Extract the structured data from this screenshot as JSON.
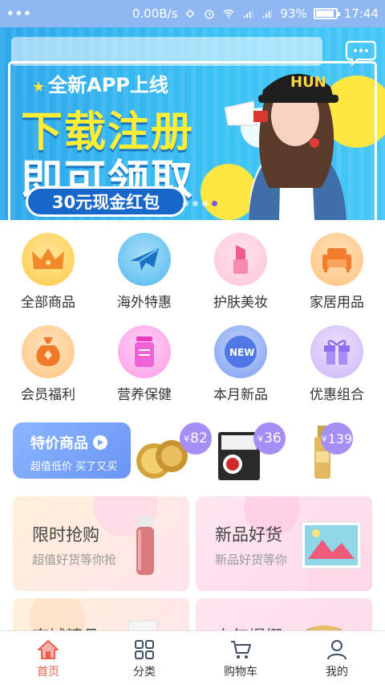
{
  "status_bar": {
    "speed": "0.00B/s",
    "battery_pct": "93%",
    "battery_level": 0.93,
    "time": "17:44"
  },
  "banner": {
    "tag": "全新APP上线",
    "line1": "下载注册",
    "line2": "即可领取",
    "pill": "30元现金红包",
    "cap_text": "HUN",
    "active_dot": 3
  },
  "categories": [
    {
      "label": "全部商品",
      "icon": "crown-icon",
      "color": "#ffd86e"
    },
    {
      "label": "海外特惠",
      "icon": "airplane-icon",
      "color": "#82cff6"
    },
    {
      "label": "护肤美妆",
      "icon": "lipstick-icon",
      "color": "#ffd0e0"
    },
    {
      "label": "家居用品",
      "icon": "sofa-icon",
      "color": "#ffd6a6"
    },
    {
      "label": "会员福利",
      "icon": "money-bag-icon",
      "color": "#ffd8a6"
    },
    {
      "label": "营养保健",
      "icon": "supplement-jar-icon",
      "color": "#ffc3ee"
    },
    {
      "label": "本月新品",
      "icon": "new-badge-icon",
      "color": "#a5bff7"
    },
    {
      "label": "优惠组合",
      "icon": "gift-icon",
      "color": "#dccbf9"
    }
  ],
  "special": {
    "title": "特价商品",
    "subtitle": "超值低价 买了又买"
  },
  "products": [
    {
      "price": "82",
      "currency": "¥",
      "icon": "eye-mask-jar-icon"
    },
    {
      "price": "36",
      "currency": "¥",
      "icon": "eye-drops-box-icon"
    },
    {
      "price": "139",
      "currency": "¥",
      "icon": "serum-bottle-icon"
    }
  ],
  "cards": [
    {
      "title": "限时抢购",
      "subtitle": "超值好货等你抢",
      "icon": "thermos-icon"
    },
    {
      "title": "新品好货",
      "subtitle": "新品好货等你",
      "icon": "book-icon"
    },
    {
      "title": "商城精品",
      "subtitle": "",
      "icon": "product-box-icon"
    },
    {
      "title": "人气爆棚",
      "subtitle": "",
      "icon": "cookie-tin-icon"
    }
  ],
  "tabs": [
    {
      "label": "首页",
      "icon": "home-icon",
      "active": true
    },
    {
      "label": "分类",
      "icon": "grid-icon",
      "active": false
    },
    {
      "label": "购物车",
      "icon": "cart-icon",
      "active": false
    },
    {
      "label": "我的",
      "icon": "user-icon",
      "active": false
    }
  ],
  "colors": {
    "status_bar": "#8fb8f3",
    "banner": "#2ea7ec",
    "accent_active_tab": "#e8604f",
    "special_block": "#7aa6fb",
    "price_bubble": "#a58ef5"
  }
}
